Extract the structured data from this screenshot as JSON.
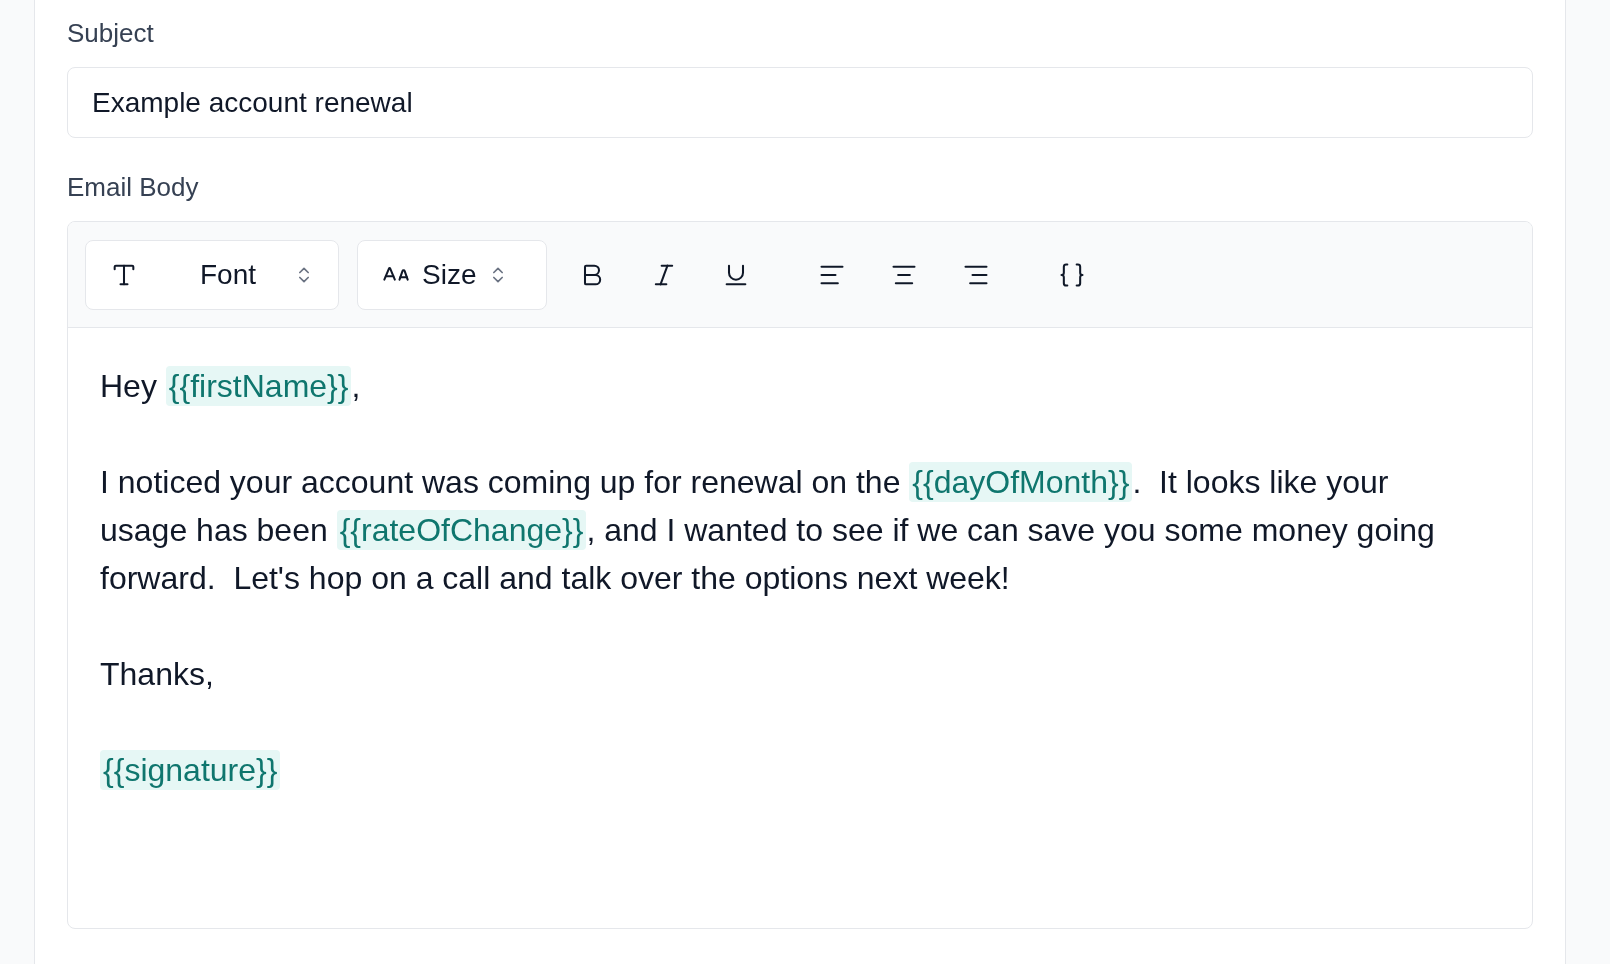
{
  "subject": {
    "label": "Subject",
    "value": "Example account renewal"
  },
  "email_body": {
    "label": "Email Body",
    "toolbar": [
      {
        "kind": "font",
        "label": "Font"
      },
      {
        "kind": "size",
        "label": "Size"
      },
      {
        "kind": "bold"
      },
      {
        "kind": "italic"
      },
      {
        "kind": "underline"
      },
      {
        "kind": "align-left"
      },
      {
        "kind": "align-center"
      },
      {
        "kind": "align-right"
      },
      {
        "kind": "variable"
      }
    ],
    "paragraphs": [
      [
        {
          "kind": "text",
          "text": "Hey "
        },
        {
          "kind": "variable",
          "text": "{{firstName}}"
        },
        {
          "kind": "text",
          "text": ","
        }
      ],
      [
        {
          "kind": "text",
          "text": "I noticed your account was coming up for renewal on the "
        },
        {
          "kind": "variable",
          "text": "{{dayOfMonth}}"
        },
        {
          "kind": "text",
          "text": ".  It looks like your usage has been "
        },
        {
          "kind": "variable",
          "text": "{{rateOfChange}}"
        },
        {
          "kind": "text",
          "text": ", and I wanted to see if we can save you some money going forward.  Let's hop on a call and talk over the options next week!"
        }
      ],
      [
        {
          "kind": "text",
          "text": "Thanks,"
        }
      ],
      [
        {
          "kind": "variable",
          "text": "{{signature}}"
        }
      ]
    ]
  }
}
